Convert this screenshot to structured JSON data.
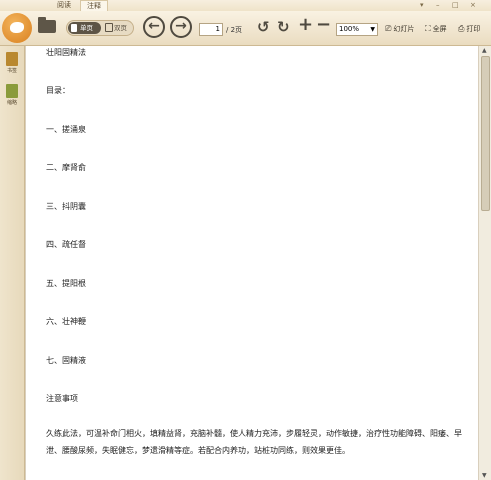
{
  "tabs": [
    {
      "label": "阅读"
    },
    {
      "label": "注释"
    }
  ],
  "window_controls": [
    "▾",
    "–",
    "□",
    "×"
  ],
  "toolbar": {
    "view_single": "单页",
    "view_double": "双页",
    "prev_symbol": "←",
    "next_symbol": "→",
    "current_page": "1",
    "total_pages": "/ 2页",
    "rotate_left_symbol": "↺",
    "rotate_right_symbol": "↻",
    "zoom_in_symbol": "+",
    "zoom_out_symbol": "−",
    "zoom_level": "100%",
    "slideshow_label": "幻灯片",
    "fullscreen_label": "全屏",
    "print_label": "打印"
  },
  "sidebar": {
    "items": [
      {
        "label": "书签",
        "icon": "bookmark-icon",
        "color": "#b9882f"
      },
      {
        "label": "缩略",
        "icon": "thumbnail-icon",
        "color": "#8a9b3b"
      }
    ]
  },
  "document": {
    "title": "壮阳固精法",
    "toc_heading": "目录：",
    "items": [
      "一、搓涌泉",
      "二、摩肾俞",
      "三、抖阴囊",
      "四、疏任督",
      "五、提阳根",
      "六、壮神鞭",
      "七、固精液"
    ],
    "notes_heading": "注意事项",
    "paragraph": "久练此法，可温补命门相火，填精益肾，充脑补髓，使人精力充沛，步履轻灵，动作敏捷，治疗性功能障碍、阳痿、早泄、腰酸尿频，失眠健忘，梦遗滑精等症。若配合内养功，站桩功同练，则效果更佳。"
  },
  "colors": {
    "accent": "#d9801f",
    "toolbar_bg": "#efe3c9",
    "page_bg": "#ffffff"
  }
}
